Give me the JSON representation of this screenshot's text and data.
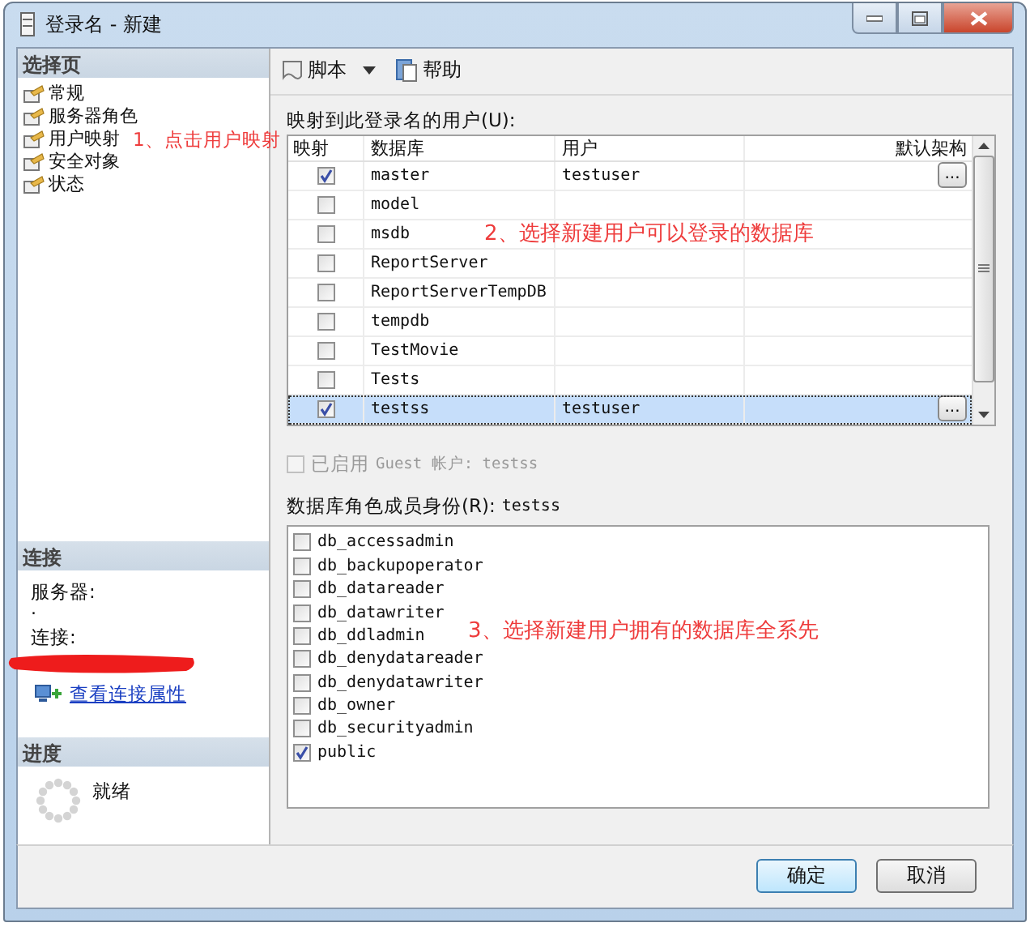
{
  "window": {
    "title": "登录名 - 新建"
  },
  "sidebar": {
    "header": "选择页",
    "pages": [
      {
        "label": "常规"
      },
      {
        "label": "服务器角色"
      },
      {
        "label": "用户映射"
      },
      {
        "label": "安全对象"
      },
      {
        "label": "状态"
      }
    ]
  },
  "connection": {
    "header": "连接",
    "server_label": "服务器:",
    "server_value": ".",
    "connection_label": "连接:",
    "link": "查看连接属性"
  },
  "progress": {
    "header": "进度",
    "status": "就绪"
  },
  "toolbar": {
    "items": [
      {
        "label": "脚本",
        "kind": "script",
        "dropdown": true
      },
      {
        "label": "帮助",
        "kind": "help",
        "dropdown": false
      }
    ]
  },
  "mapping": {
    "label": "映射到此登录名的用户(U):",
    "columns": [
      "映射",
      "数据库",
      "用户",
      "默认架构"
    ],
    "rows": [
      {
        "mapped": true,
        "database": "master",
        "user": "testuser",
        "browse": "...",
        "selected": false
      },
      {
        "mapped": false,
        "database": "model",
        "selected": false
      },
      {
        "mapped": false,
        "database": "msdb",
        "selected": false
      },
      {
        "mapped": false,
        "database": "ReportServer",
        "selected": false
      },
      {
        "mapped": false,
        "database": "ReportServerTempDB",
        "selected": false
      },
      {
        "mapped": false,
        "database": "tempdb",
        "selected": false
      },
      {
        "mapped": false,
        "database": "TestMovie",
        "selected": false
      },
      {
        "mapped": false,
        "database": "Tests",
        "selected": false
      },
      {
        "mapped": true,
        "database": "testss",
        "user": "testuser",
        "browse": "...",
        "selected": true
      }
    ]
  },
  "guest": {
    "label": "已启用",
    "detail": "Guest 帐户: testss",
    "checked": false,
    "disabled": true
  },
  "roles": {
    "label": "数据库角色成员身份(R):",
    "database": "testss",
    "items": [
      {
        "name": "db_accessadmin",
        "checked": false
      },
      {
        "name": "db_backupoperator",
        "checked": false
      },
      {
        "name": "db_datareader",
        "checked": false
      },
      {
        "name": "db_datawriter",
        "checked": false
      },
      {
        "name": "db_ddladmin",
        "checked": false
      },
      {
        "name": "db_denydatareader",
        "checked": false
      },
      {
        "name": "db_denydatawriter",
        "checked": false
      },
      {
        "name": "db_owner",
        "checked": false
      },
      {
        "name": "db_securityadmin",
        "checked": false
      },
      {
        "name": "public",
        "checked": true
      }
    ]
  },
  "buttons": [
    {
      "label": "确定",
      "default": true
    },
    {
      "label": "取消",
      "default": false
    }
  ],
  "annotations": [
    {
      "kind": "note",
      "text": "1、点击用户映射"
    },
    {
      "kind": "note",
      "text": "2、选择新建用户可以登录的数据库"
    },
    {
      "kind": "note",
      "text": "3、选择新建用户拥有的数据库全系先"
    },
    {
      "kind": "scribble"
    }
  ]
}
